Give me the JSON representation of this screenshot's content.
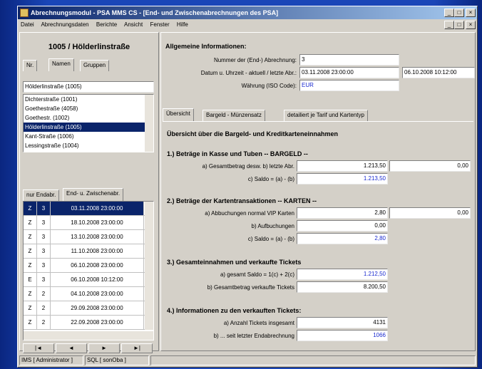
{
  "window": {
    "title": "Abrechnungsmodul - PSA MMS CS - [End- und Zwischenabrechnungen des PSA]",
    "menu": [
      "Datei",
      "Abrechnungsdaten",
      "Berichte",
      "Ansicht",
      "Fenster",
      "Hilfe"
    ]
  },
  "left": {
    "header": "1005 / Hölderlinstraße",
    "tabs": [
      "Nr.",
      "Namen",
      "Gruppen"
    ],
    "search_value": "Hölderlinstraße (1005)",
    "stations": [
      "Dichterstraße (1001)",
      "Goethestraße (4058)",
      "Goethestr. (1002)",
      "Hölderlinstraße (1005)",
      "Kant-Straße (1006)",
      "Lessingstraße (1004)"
    ],
    "selected_station_index": 3,
    "list_tabs": [
      "nur Endabr.",
      "End- u. Zwischenabr."
    ],
    "rows": [
      {
        "type": "Z",
        "nr": "3",
        "date": "03.11.2008 23:00:00"
      },
      {
        "type": "Z",
        "nr": "3",
        "date": "18.10.2008 23:00:00"
      },
      {
        "type": "Z",
        "nr": "3",
        "date": "13.10.2008 23:00:00"
      },
      {
        "type": "Z",
        "nr": "3",
        "date": "11.10.2008 23:00:00"
      },
      {
        "type": "Z",
        "nr": "3",
        "date": "06.10.2008 23:00:00"
      },
      {
        "type": "E",
        "nr": "3",
        "date": "06.10.2008 10:12:00"
      },
      {
        "type": "Z",
        "nr": "2",
        "date": "04.10.2008 23:00:00"
      },
      {
        "type": "Z",
        "nr": "2",
        "date": "29.09.2008 23:00:00"
      },
      {
        "type": "Z",
        "nr": "2",
        "date": "22.09.2008 23:00:00"
      }
    ],
    "selected_row_index": 0,
    "nav_buttons": [
      "|◄",
      "◄",
      "►",
      "►|"
    ]
  },
  "right": {
    "general_title": "Allgemeine Informationen:",
    "nr_label": "Nummer der (End-) Abrechnung:",
    "nr_value": "3",
    "date_label": "Datum u. Uhrzeit - aktuell / letzte Abr.:",
    "date_current": "03.11.2008 23:00:00",
    "date_last": "06.10.2008 10:12:00",
    "currency_label": "Währung (ISO Code):",
    "currency_value": "EUR",
    "tabs": [
      "Übersicht",
      "Bargeld - Münzensatz",
      "detailiert je Tarif und Kartentyp"
    ],
    "overview_title": "Übersicht über die Bargeld- und Kreditkarteneinnahmen",
    "sec1_title": "1.) Beträge in Kasse und Tuben -- BARGELD --",
    "sec1": [
      {
        "label": "a) Gesamtbetrag desw. b) letzte Abr.",
        "v1": "1.213,50",
        "v2": "0,00"
      },
      {
        "label": "c) Saldo = (a) - (b)",
        "v1": "1.213,50",
        "v2": ""
      }
    ],
    "sec2_title": "2.) Beträge der Kartentransaktionen -- KARTEN --",
    "sec2": [
      {
        "label": "a) Abbuchungen normal VIP Karten",
        "v1": "2,80",
        "v2": "0,00"
      },
      {
        "label": "b) Aufbuchungen",
        "v1": "0,00",
        "v2": ""
      },
      {
        "label": "c) Saldo = (a) - (b)",
        "v1": "2,80",
        "v2": ""
      }
    ],
    "sec3_title": "3.) Gesamteinnahmen und verkaufte Tickets",
    "sec3": [
      {
        "label": "a) gesamt Saldo = 1(c) + 2(c)",
        "v1": "1.212,50"
      },
      {
        "label": "b) Gesamtbetrag verkaufte Tickets",
        "v1": "8.200,50"
      }
    ],
    "sec4_title": "4.) Informationen zu den verkauften Tickets:",
    "sec4": [
      {
        "label": "a) Anzahl Tickets insgesamt",
        "v1": "4131"
      },
      {
        "label": "b) ... seit letzter Endabrechnung",
        "v1": "1066"
      }
    ]
  },
  "status": {
    "user": "IMS [ Administrator ]",
    "db": "SQL [ sonOba ]"
  },
  "colors": {
    "selection": "#0a246a",
    "value_blue": "#1a2ad0",
    "face": "#d4d0c8"
  }
}
